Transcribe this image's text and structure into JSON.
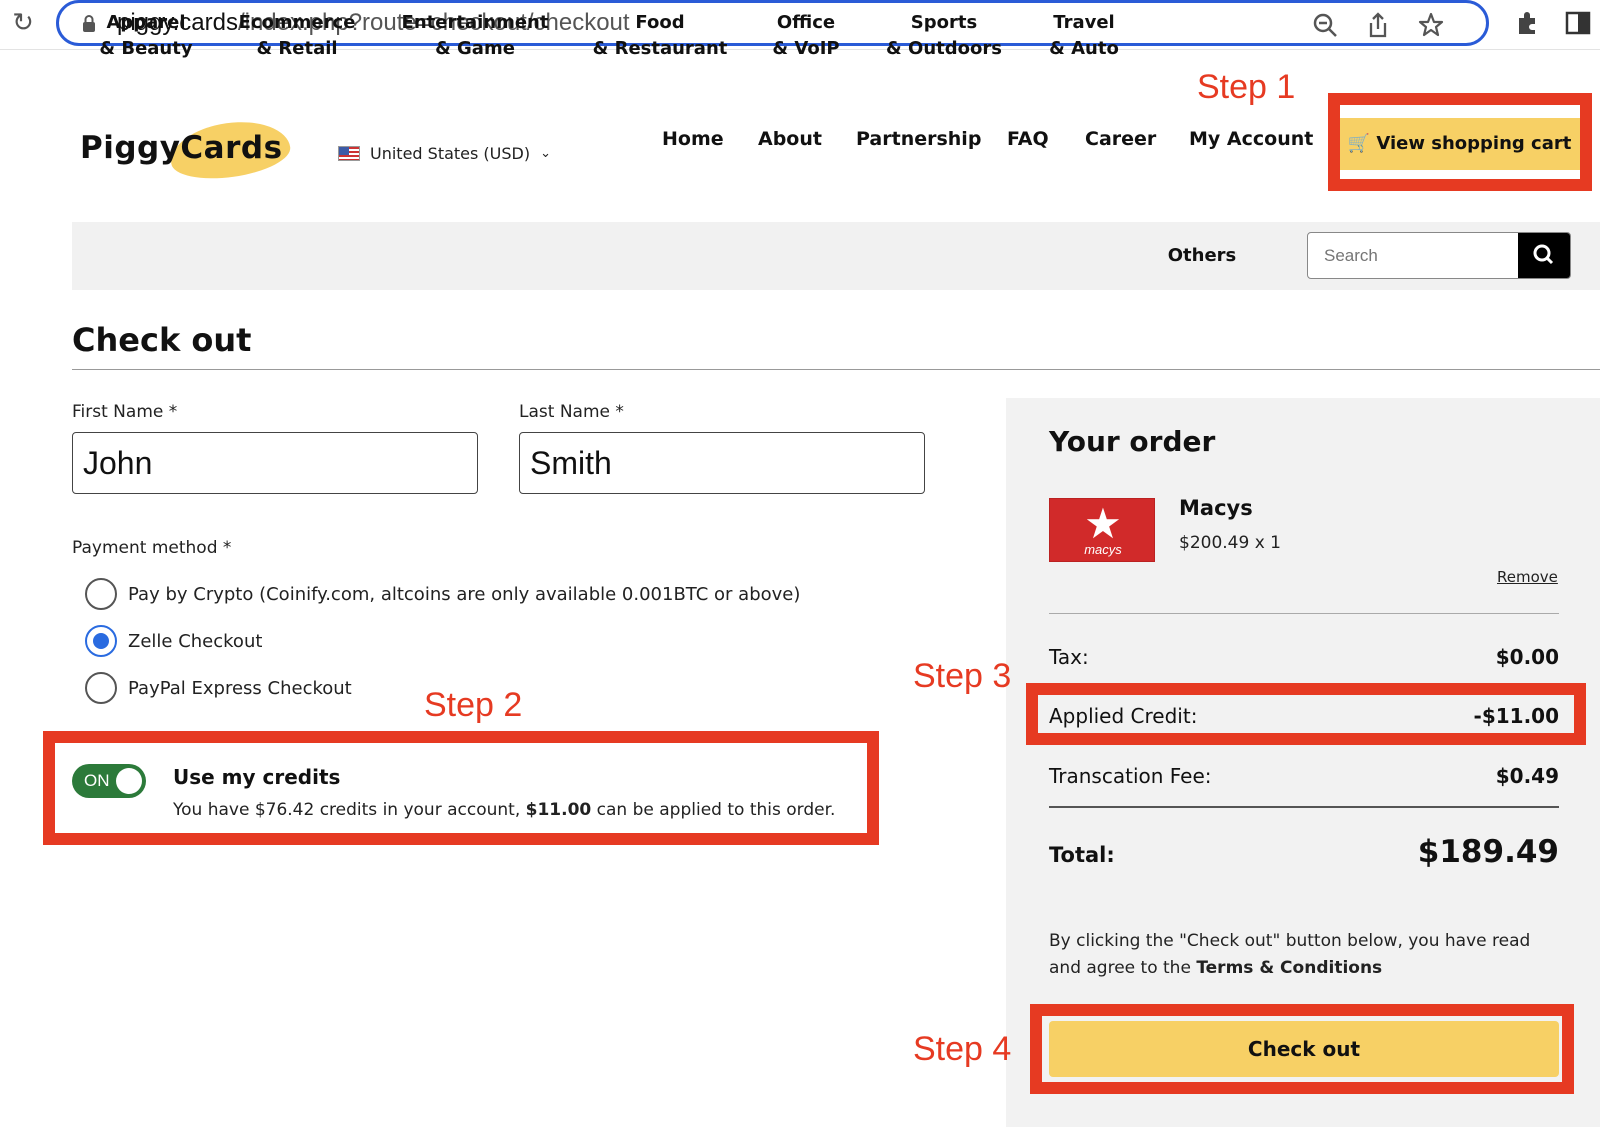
{
  "browser": {
    "url_host": "piggy.cards",
    "url_path": "/index.php?route=checkout/checkout"
  },
  "header": {
    "logo_text": "PiggyCards",
    "currency": "United States (USD)",
    "nav": [
      "Home",
      "About",
      "Partnership",
      "FAQ",
      "Career",
      "My Account"
    ],
    "cart_button": "View shopping cart",
    "accent_color": "#f7d065"
  },
  "categories": [
    {
      "line1": "Apparel",
      "line2": "& Beauty"
    },
    {
      "line1": "Ecommerce",
      "line2": "& Retail"
    },
    {
      "line1": "Entertainment",
      "line2": "& Game"
    },
    {
      "line1": "Food",
      "line2": "& Restaurant"
    },
    {
      "line1": "Office",
      "line2": "& VoIP"
    },
    {
      "line1": "Sports",
      "line2": "& Outdoors"
    },
    {
      "line1": "Travel",
      "line2": "& Auto"
    },
    {
      "line1": "Others",
      "line2": ""
    }
  ],
  "search": {
    "placeholder": "Search"
  },
  "page": {
    "title": "Check out"
  },
  "form": {
    "first_name_label": "First Name *",
    "first_name_value": "John",
    "last_name_label": "Last Name *",
    "last_name_value": "Smith",
    "payment_label": "Payment method *",
    "payment_options": [
      {
        "label": "Pay by Crypto (Coinify.com, altcoins are only available 0.001BTC or above)",
        "selected": false
      },
      {
        "label": "Zelle Checkout",
        "selected": true
      },
      {
        "label": "PayPal Express Checkout",
        "selected": false
      }
    ]
  },
  "credits": {
    "toggle_label": "ON",
    "title": "Use my credits",
    "desc_prefix": "You have $76.42 credits in your account,",
    "desc_amount": "$11.00",
    "desc_suffix": "can be applied to this order."
  },
  "order": {
    "title": "Your order",
    "item_name": "Macys",
    "item_brand_text": "macys",
    "item_price": "$200.49 x 1",
    "remove": "Remove",
    "tax_label": "Tax:",
    "tax_value": "$0.00",
    "credit_label": "Applied Credit:",
    "credit_value": "-$11.00",
    "fee_label": "Transcation Fee:",
    "fee_value": "$0.49",
    "total_label": "Total:",
    "total_value": "$189.49",
    "terms_text": "By clicking the \"Check out\" button below, you have read and agree to the",
    "terms_link": "Terms & Conditions",
    "checkout_button": "Check out"
  },
  "annotations": {
    "step1": "Step 1",
    "step2": "Step 2",
    "step3": "Step 3",
    "step4": "Step 4",
    "color": "#e63a22"
  }
}
